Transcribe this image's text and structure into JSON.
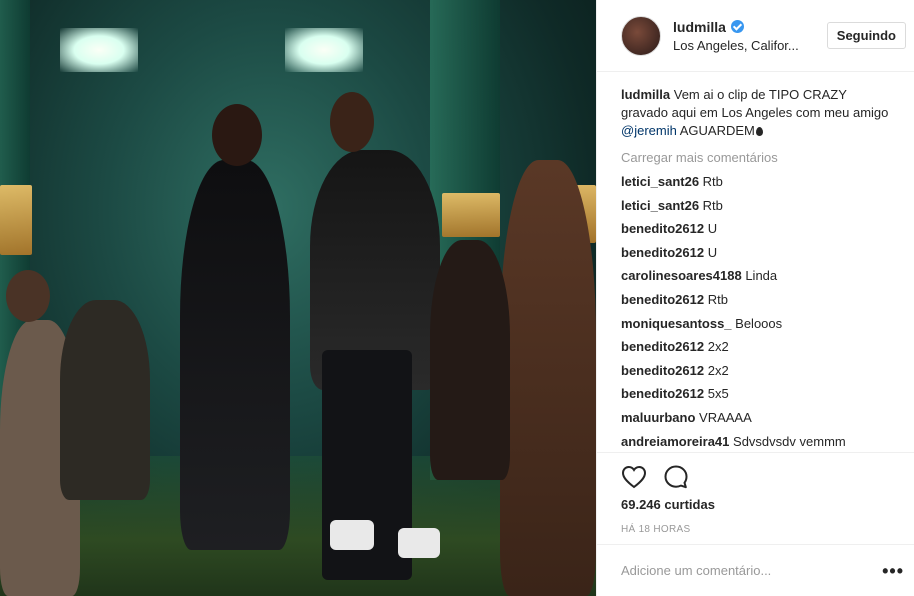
{
  "post": {
    "image_alt": "Music video still: woman and man posing in a green-lit room with people lounging around"
  },
  "header": {
    "username": "ludmilla",
    "verified": true,
    "location": "Los Angeles, Califor...",
    "follow_label": "Seguindo"
  },
  "caption": {
    "username": "ludmilla",
    "text_before": "Vem ai o clip de TIPO CRAZY gravado aqui em Los Angeles com meu amigo",
    "mention": "@jeremih",
    "text_after": "AGUARDEM"
  },
  "load_more_label": "Carregar mais comentários",
  "comments": [
    {
      "user": "letici_sant26",
      "text": "Rtb"
    },
    {
      "user": "letici_sant26",
      "text": "Rtb"
    },
    {
      "user": "benedito2612",
      "text": "U"
    },
    {
      "user": "benedito2612",
      "text": "U"
    },
    {
      "user": "carolinesoares4188",
      "text": "Linda"
    },
    {
      "user": "benedito2612",
      "text": "Rtb"
    },
    {
      "user": "moniquesantoss_",
      "text": "Belooos"
    },
    {
      "user": "benedito2612",
      "text": "2x2"
    },
    {
      "user": "benedito2612",
      "text": "2x2"
    },
    {
      "user": "benedito2612",
      "text": "5x5"
    },
    {
      "user": "maluurbano",
      "text": "VRAAAA"
    },
    {
      "user": "andreiamoreira41",
      "text": "Sdvsdvsdv vemmm"
    }
  ],
  "actions": {
    "like_icon": "heart-icon",
    "comment_icon": "comment-icon"
  },
  "likes_text": "69.246 curtidas",
  "time_ago": "HÁ 18 HORAS",
  "add_comment": {
    "placeholder": "Adicione um comentário...",
    "more_icon": "more-options-icon"
  }
}
